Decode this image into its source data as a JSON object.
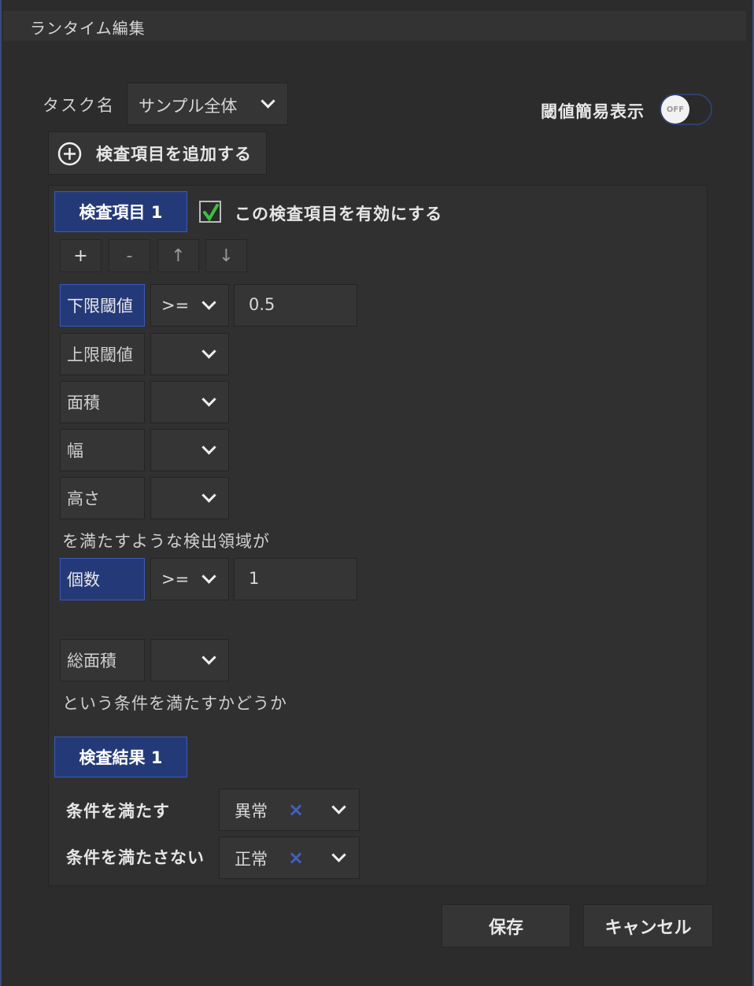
{
  "window": {
    "title": "ランタイム編集"
  },
  "header": {
    "task_label": "タスク名",
    "task_value": "サンプル全体",
    "add_item_label": "検査項目を追加する",
    "toggle_label": "閾値簡易表示",
    "toggle_state": "OFF"
  },
  "inspection": {
    "tab_label": "検査項目 1",
    "enable_label": "この検査項目を有効にする",
    "toolbar": {
      "add": "+",
      "remove": "-",
      "up": "↑",
      "down": "↓"
    },
    "conditions": [
      {
        "label": "下限閾値",
        "operator": ">=",
        "value": "0.5"
      },
      {
        "label": "上限閾値",
        "operator": "",
        "value": ""
      },
      {
        "label": "面積",
        "operator": ""
      },
      {
        "label": "幅",
        "operator": ""
      },
      {
        "label": "高さ",
        "operator": ""
      }
    ],
    "middle_text": "を満たすような検出領域が",
    "count": {
      "label": "個数",
      "operator": ">=",
      "value": "1"
    },
    "total_area": {
      "label": "総面積",
      "operator": ""
    },
    "bottom_text": "という条件を満たすかどうか"
  },
  "result": {
    "tab_label": "検査結果 1",
    "satisfied_label": "条件を満たす",
    "satisfied_value": "異常",
    "unsatisfied_label": "条件を満たさない",
    "unsatisfied_value": "正常"
  },
  "footer": {
    "save_label": "保存",
    "cancel_label": "キャンセル"
  },
  "colors": {
    "accent": "#243a78",
    "check": "#3cc040",
    "clear": "#3f62c0"
  }
}
